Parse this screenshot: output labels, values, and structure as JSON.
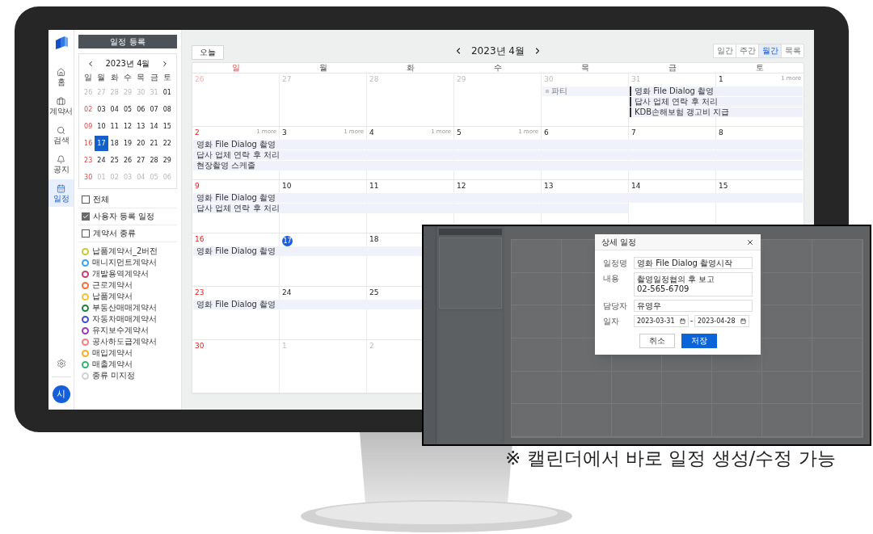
{
  "nav": {
    "items": [
      {
        "label": "홈",
        "kind": "home",
        "selected": false
      },
      {
        "label": "계약서",
        "kind": "contracts",
        "selected": false
      },
      {
        "label": "검색",
        "kind": "search",
        "selected": false
      },
      {
        "label": "공지",
        "kind": "notice",
        "selected": false
      },
      {
        "label": "일정",
        "kind": "schedule",
        "selected": true
      }
    ],
    "avatar": "시"
  },
  "left_panel": {
    "add_button": "일정 등록",
    "mini_calendar": {
      "title": "2023년 4월",
      "weekdays": [
        "일",
        "월",
        "화",
        "수",
        "목",
        "금",
        "토"
      ],
      "weeks": [
        [
          {
            "label": "26",
            "muted": true,
            "selected": false
          },
          {
            "label": "27",
            "muted": true,
            "selected": false
          },
          {
            "label": "28",
            "muted": true,
            "selected": false
          },
          {
            "label": "29",
            "muted": true,
            "selected": false
          },
          {
            "label": "30",
            "muted": true,
            "selected": false
          },
          {
            "label": "31",
            "muted": true,
            "selected": false
          },
          {
            "label": "01",
            "muted": false,
            "selected": false
          }
        ],
        [
          {
            "label": "02",
            "muted": false,
            "selected": false
          },
          {
            "label": "03",
            "muted": false,
            "selected": false
          },
          {
            "label": "04",
            "muted": false,
            "selected": false
          },
          {
            "label": "05",
            "muted": false,
            "selected": false
          },
          {
            "label": "06",
            "muted": false,
            "selected": false
          },
          {
            "label": "07",
            "muted": false,
            "selected": false
          },
          {
            "label": "08",
            "muted": false,
            "selected": false
          }
        ],
        [
          {
            "label": "09",
            "muted": false,
            "selected": false
          },
          {
            "label": "10",
            "muted": false,
            "selected": false
          },
          {
            "label": "11",
            "muted": false,
            "selected": false
          },
          {
            "label": "12",
            "muted": false,
            "selected": false
          },
          {
            "label": "13",
            "muted": false,
            "selected": false
          },
          {
            "label": "14",
            "muted": false,
            "selected": false
          },
          {
            "label": "15",
            "muted": false,
            "selected": false
          }
        ],
        [
          {
            "label": "16",
            "muted": false,
            "selected": false
          },
          {
            "label": "17",
            "selected": true
          },
          {
            "label": "18",
            "muted": false,
            "selected": false
          },
          {
            "label": "19",
            "muted": false,
            "selected": false
          },
          {
            "label": "20",
            "muted": false,
            "selected": false
          },
          {
            "label": "21",
            "muted": false,
            "selected": false
          },
          {
            "label": "22",
            "muted": false,
            "selected": false
          }
        ],
        [
          {
            "label": "23",
            "muted": false,
            "selected": false
          },
          {
            "label": "24",
            "muted": false,
            "selected": false
          },
          {
            "label": "25",
            "muted": false,
            "selected": false
          },
          {
            "label": "26",
            "muted": false,
            "selected": false
          },
          {
            "label": "27",
            "muted": false,
            "selected": false
          },
          {
            "label": "28",
            "muted": false,
            "selected": false
          },
          {
            "label": "29",
            "muted": false,
            "selected": false
          }
        ],
        [
          {
            "label": "30",
            "muted": false,
            "selected": false
          },
          {
            "label": "01",
            "muted": true,
            "selected": false
          },
          {
            "label": "02",
            "muted": true,
            "selected": false
          },
          {
            "label": "03",
            "muted": true,
            "selected": false
          },
          {
            "label": "04",
            "muted": true,
            "selected": false
          },
          {
            "label": "05",
            "muted": true,
            "selected": false
          },
          {
            "label": "06",
            "muted": true,
            "selected": false
          }
        ]
      ]
    },
    "filters": [
      {
        "label": "전체",
        "checked": false
      },
      {
        "label": "사용자 등록 일정",
        "checked": true
      },
      {
        "label": "계약서 종류",
        "checked": false
      }
    ],
    "contract_types": [
      {
        "label": "납품계약서_2버전",
        "color": "#c8c83c"
      },
      {
        "label": "매니지먼트계약서",
        "color": "#3aa0e8"
      },
      {
        "label": "개발용역계약서",
        "color": "#c04070"
      },
      {
        "label": "근로계약서",
        "color": "#f07040"
      },
      {
        "label": "납품계약서",
        "color": "#f0c040"
      },
      {
        "label": "부동산매매계약서",
        "color": "#208040"
      },
      {
        "label": "자동차매매계약서",
        "color": "#4050c0"
      },
      {
        "label": "유지보수계약서",
        "color": "#9040b0"
      },
      {
        "label": "공사하도급계약서",
        "color": "#f08080"
      },
      {
        "label": "매입계약서",
        "color": "#f0b030"
      },
      {
        "label": "매출계약서",
        "color": "#40b070"
      },
      {
        "label": "종류 미지정",
        "color": "#d0d0d0"
      }
    ]
  },
  "toolbar": {
    "today_button": "오늘",
    "title": "2023년 4월",
    "views": [
      {
        "label": "일간",
        "selected": false
      },
      {
        "label": "주간",
        "selected": false
      },
      {
        "label": "월간",
        "selected": true
      },
      {
        "label": "목록",
        "selected": false
      }
    ]
  },
  "calendar": {
    "weekdays": [
      "일",
      "월",
      "화",
      "수",
      "목",
      "금",
      "토"
    ],
    "weeks": [
      {
        "days": [
          {
            "label": "26",
            "muted": true,
            "today": false
          },
          {
            "label": "27",
            "muted": true,
            "today": false
          },
          {
            "label": "28",
            "muted": true,
            "today": false
          },
          {
            "label": "29",
            "muted": true,
            "today": false
          },
          {
            "label": "30",
            "muted": true,
            "today": false,
            "events": [
              {
                "label": "파티",
                "kind": "tag"
              }
            ]
          },
          {
            "label": "31",
            "muted": true,
            "today": false,
            "events": [
              {
                "label": "영화 File Dialog 촬영",
                "kind": "note"
              },
              {
                "label": "답사 업체 연락 후 처리",
                "kind": "note"
              },
              {
                "label": "KDB손해보험 갱고비 지급",
                "kind": "note"
              }
            ]
          },
          {
            "label": "1",
            "muted": false,
            "today": false,
            "more": "1 more"
          }
        ]
      },
      {
        "days": [
          {
            "label": "2",
            "muted": false,
            "today": false,
            "more": "1 more",
            "events": [
              {
                "label": "영화 File Dialog 촬영",
                "kind": "band"
              },
              {
                "label": "답사 업체 연락 후 처리",
                "kind": "band"
              },
              {
                "label": "현장촬영 스케줄",
                "kind": "band"
              }
            ]
          },
          {
            "label": "3",
            "muted": false,
            "today": false,
            "more": "1 more"
          },
          {
            "label": "4",
            "muted": false,
            "today": false,
            "more": "1 more"
          },
          {
            "label": "5",
            "muted": false,
            "today": false,
            "more": "1 more"
          },
          {
            "label": "6",
            "muted": false,
            "today": false
          },
          {
            "label": "7",
            "muted": false,
            "today": false
          },
          {
            "label": "8",
            "muted": false,
            "today": false
          }
        ]
      },
      {
        "days": [
          {
            "label": "9",
            "muted": false,
            "today": false,
            "events": [
              {
                "label": "영화 File Dialog 촬영",
                "kind": "band"
              },
              {
                "label": "답사 업체 연락 후 처리",
                "kind": "strip"
              }
            ]
          },
          {
            "label": "10",
            "muted": false,
            "today": false
          },
          {
            "label": "11",
            "muted": false,
            "today": false
          },
          {
            "label": "12",
            "muted": false,
            "today": false
          },
          {
            "label": "13",
            "muted": false,
            "today": false
          },
          {
            "label": "14",
            "muted": false,
            "today": false
          },
          {
            "label": "15",
            "muted": false,
            "today": false
          }
        ]
      },
      {
        "days": [
          {
            "label": "16",
            "muted": false,
            "today": false,
            "events": [
              {
                "label": "영화 File Dialog 촬영",
                "kind": "band"
              }
            ]
          },
          {
            "label": "17",
            "today": true
          },
          {
            "label": "18",
            "muted": false,
            "today": false
          }
        ]
      },
      {
        "days": [
          {
            "label": "23",
            "muted": false,
            "today": false,
            "events": [
              {
                "label": "영화 File Dialog 촬영",
                "kind": "band"
              }
            ]
          },
          {
            "label": "24",
            "muted": false,
            "today": false
          },
          {
            "label": "25",
            "muted": false,
            "today": false
          }
        ]
      },
      {
        "days": [
          {
            "label": "30",
            "muted": false,
            "today": false
          },
          {
            "label": "1",
            "muted": true,
            "today": false
          },
          {
            "label": "2",
            "muted": true,
            "today": false
          }
        ]
      }
    ]
  },
  "inset": {
    "dialog": {
      "title": "상세 일정",
      "fields": [
        {
          "label": "일정명",
          "kind": "text",
          "value": "영화 File Dialog 촬영시작"
        },
        {
          "label": "내용",
          "kind": "multiline",
          "lines": [
            "촬영일정협의 후 보고",
            "02-565-6709"
          ]
        },
        {
          "label": "담당자",
          "kind": "text",
          "value": "유영우"
        },
        {
          "label": "일자",
          "kind": "date_range",
          "from": "2023-03-31",
          "to": "2023-04-28"
        }
      ],
      "buttons": [
        {
          "label": "취소",
          "kind": "secondary"
        },
        {
          "label": "저장",
          "kind": "primary"
        }
      ]
    }
  },
  "caption": "※ 캘린더에서 바로 일정 생성/수정 가능"
}
